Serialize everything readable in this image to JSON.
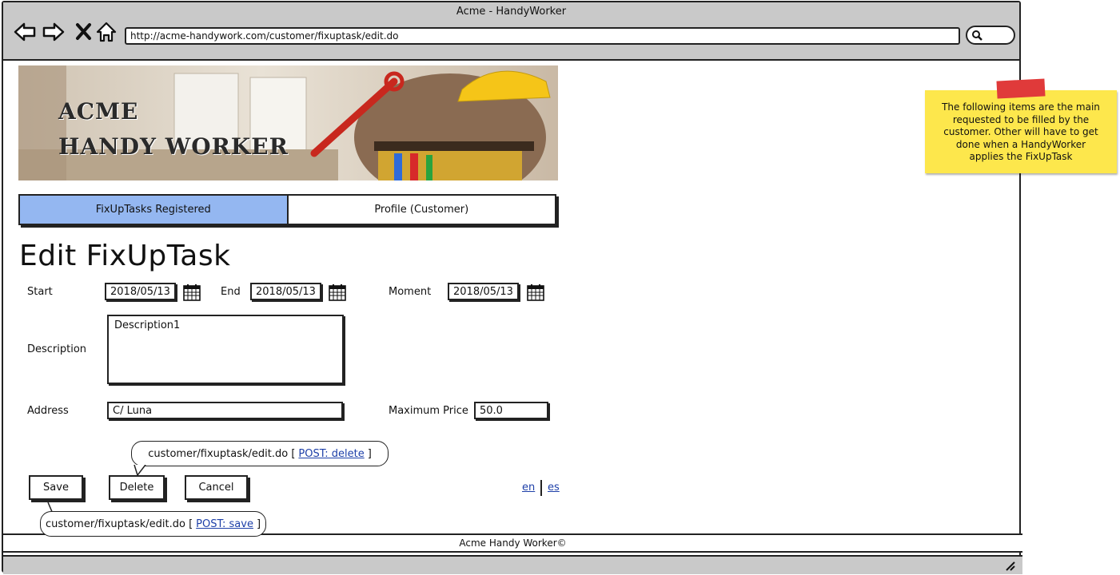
{
  "window": {
    "title": "Acme - HandyWorker"
  },
  "browser": {
    "url": "http://acme-handywork.com/customer/fixuptask/edit.do"
  },
  "banner": {
    "line1": "ACME",
    "line2": "HANDY WORKER"
  },
  "tabs": [
    {
      "label": "FixUpTasks Registered",
      "active": true
    },
    {
      "label": "Profile (Customer)",
      "active": false
    }
  ],
  "page": {
    "title": "Edit FixUpTask"
  },
  "form": {
    "start_label": "Start",
    "start_value": "2018/05/13",
    "end_label": "End",
    "end_value": "2018/05/13",
    "moment_label": "Moment",
    "moment_value": "2018/05/13",
    "description_label": "Description",
    "description_value": "Description1",
    "address_label": "Address",
    "address_value": "C/ Luna",
    "max_price_label": "Maximum Price",
    "max_price_value": "50.0"
  },
  "buttons": {
    "save": "Save",
    "delete": "Delete",
    "cancel": "Cancel"
  },
  "callouts": {
    "delete_prefix": "customer/fixuptask/edit.do [",
    "delete_link": "POST: delete",
    "delete_suffix": "]",
    "save_prefix": "customer/fixuptask/edit.do [",
    "save_link": "POST: save",
    "save_suffix": "]"
  },
  "languages": {
    "en": "en",
    "es": "es"
  },
  "footer": {
    "text": "Acme Handy Worker©"
  },
  "note": {
    "text": "The following items are the main requested to be filled by the customer. Other will have to get done when a HandyWorker applies the FixUpTask"
  },
  "colors": {
    "active_tab": "#94b7f1",
    "sticky": "#fde74c",
    "tape": "#e03a3a",
    "link": "#1d3fa8",
    "chrome": "#c9c9c9"
  }
}
